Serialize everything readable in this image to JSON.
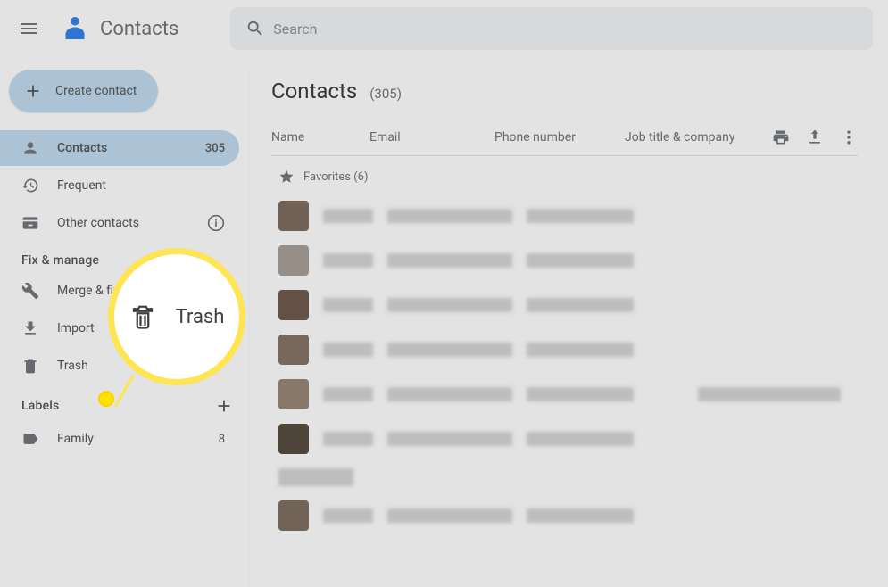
{
  "header": {
    "app_name": "Contacts",
    "search_placeholder": "Search"
  },
  "sidebar": {
    "create_label": "Create contact",
    "nav": {
      "contacts": {
        "label": "Contacts",
        "count": "305"
      },
      "frequent": {
        "label": "Frequent"
      },
      "other": {
        "label": "Other contacts"
      }
    },
    "fix_manage": {
      "header": "Fix & manage",
      "merge": {
        "label": "Merge & fix"
      },
      "import": {
        "label": "Import"
      },
      "trash": {
        "label": "Trash"
      }
    },
    "labels": {
      "header": "Labels",
      "family": {
        "label": "Family",
        "count": "8"
      }
    }
  },
  "main": {
    "title": "Contacts",
    "count_display": "(305)",
    "columns": {
      "name": "Name",
      "email": "Email",
      "phone": "Phone number",
      "job": "Job title & company"
    },
    "favorites_label": "Favorites (6)"
  },
  "callout": {
    "label": "Trash"
  }
}
